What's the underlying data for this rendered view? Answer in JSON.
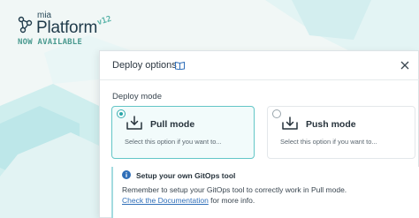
{
  "brand": {
    "small_word": "mia",
    "product_name": "Platform",
    "version": "v12",
    "availability": "NOW AVAILABLE"
  },
  "modal": {
    "title": "Deploy options",
    "section_label": "Deploy mode",
    "options": [
      {
        "title": "Pull mode",
        "description": "Select this option if you want to...",
        "selected": true
      },
      {
        "title": "Push mode",
        "description": "Select this option if you want to...",
        "selected": false
      }
    ],
    "info": {
      "title": "Setup your own GitOps tool",
      "text": "Remember to setup your GitOps tool to correctly work in Pull mode.",
      "link_text": "Check the Documentation",
      "link_suffix": " for more info."
    }
  },
  "colors": {
    "accent": "#2aa6a8",
    "info_icon": "#2f6eb8",
    "link": "#2f6eb8"
  },
  "icons": [
    "network-logo-icon",
    "book-icon",
    "close-icon",
    "pull-download-icon",
    "push-upload-icon",
    "info-icon"
  ]
}
